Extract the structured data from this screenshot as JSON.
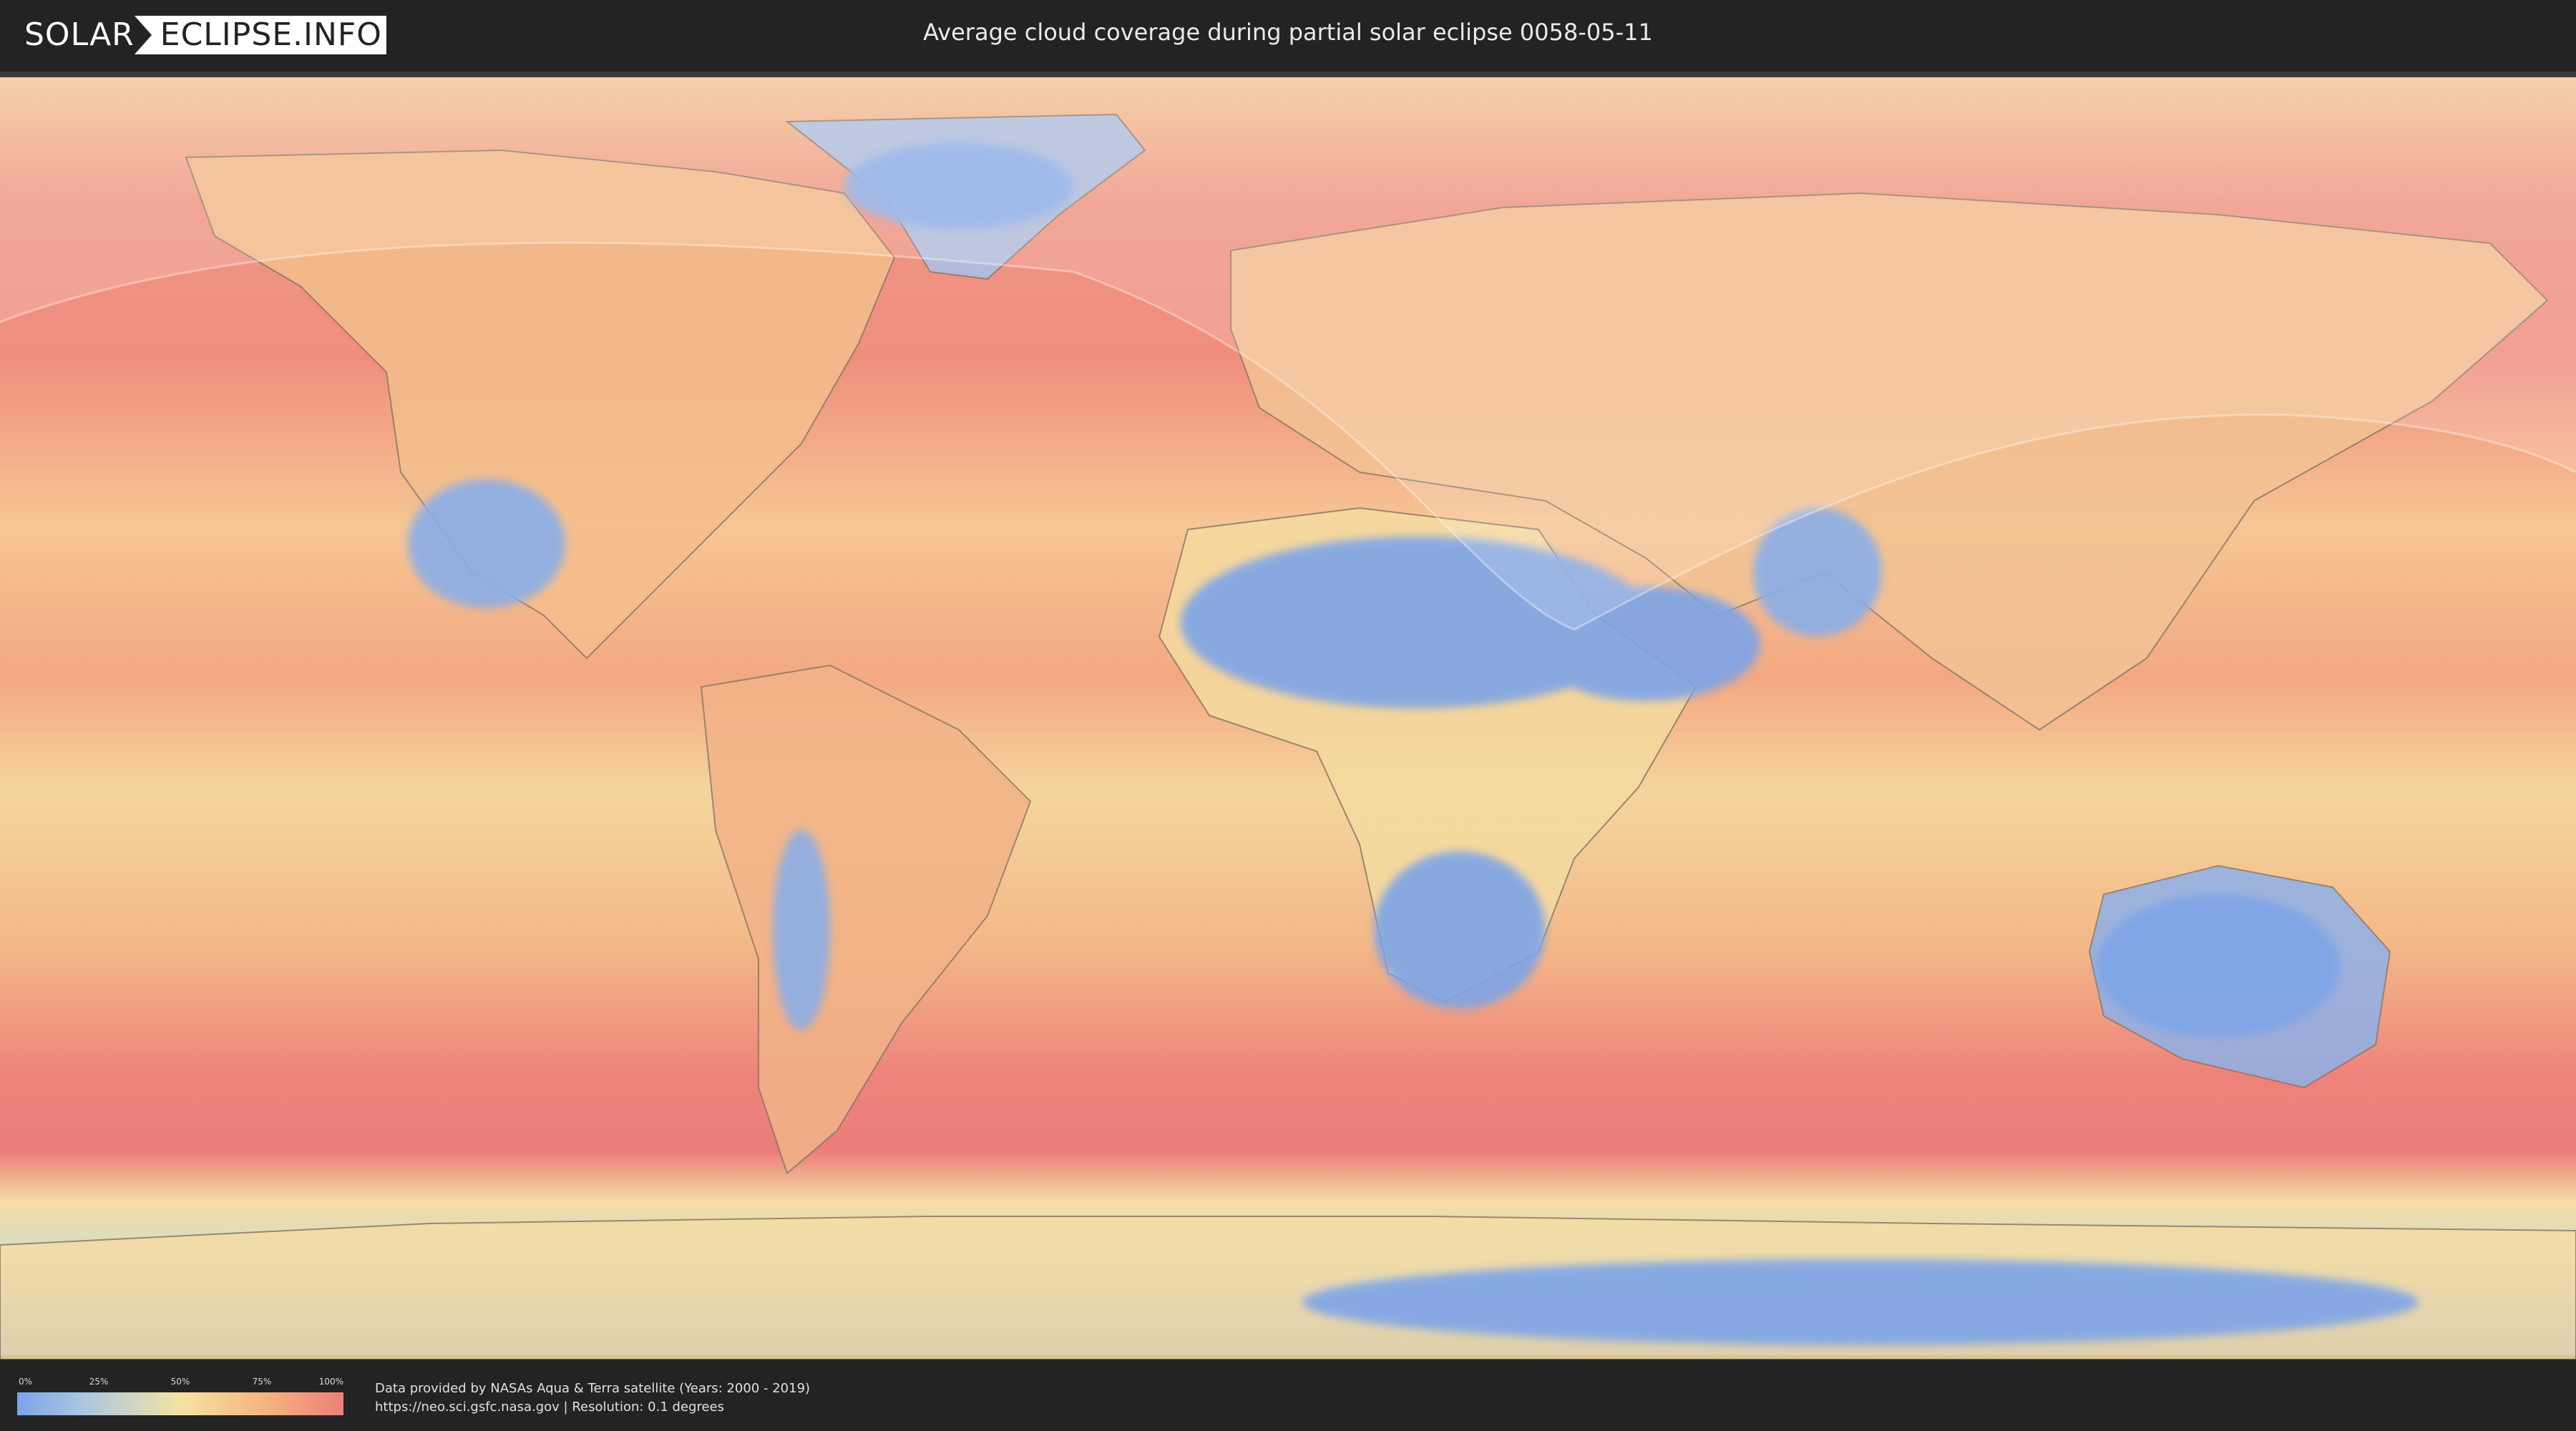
{
  "header": {
    "logo": {
      "part1": "SOLAR",
      "part2": "ECLIPSE.INFO"
    },
    "title": "Average cloud coverage during partial solar eclipse 0058-05-11"
  },
  "map": {
    "projection": "equirectangular",
    "base_layer": "average cloud coverage",
    "eclipse_overlay": "partial eclipse visibility region (light translucent shading)",
    "colors": {
      "ocean_high_cloud": "#ee7f7a",
      "mid_cloud": "#f5e3a3",
      "low_cloud": "#7da4e8",
      "eclipse_shade": "#ffffff"
    }
  },
  "legend": {
    "ticks": [
      "0%",
      "25%",
      "50%",
      "75%",
      "100%"
    ],
    "colors": [
      "#7da4e8",
      "#a9c6e3",
      "#f5e3a3",
      "#f4b77e",
      "#ee7f7a"
    ]
  },
  "footer": {
    "credit_line1": "Data provided by NASAs Aqua & Terra satellite (Years: 2000 - 2019)",
    "credit_line2": "https://neo.sci.gsfc.nasa.gov | Resolution: 0.1 degrees"
  }
}
